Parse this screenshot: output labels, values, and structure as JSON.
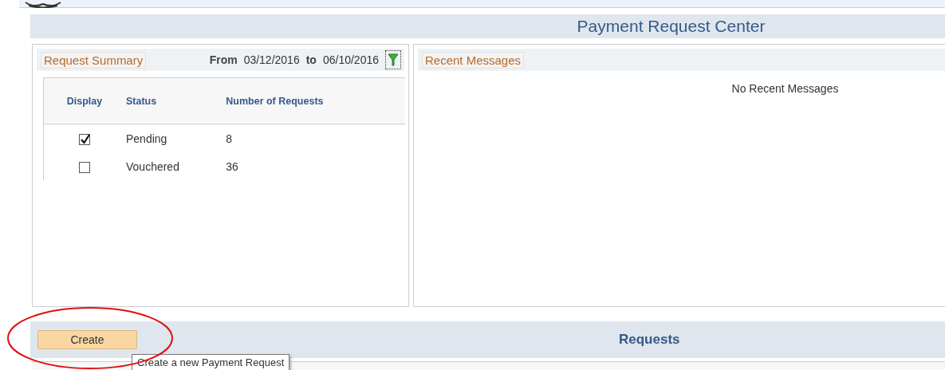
{
  "header": {
    "title": "Payment Request Center"
  },
  "summary": {
    "title": "Request Summary",
    "from_label": "From",
    "from_date": "03/12/2016",
    "to_label": "to",
    "to_date": "06/10/2016",
    "columns": [
      "Display",
      "Status",
      "Number of Requests"
    ],
    "rows": [
      {
        "status": "Pending",
        "count": "8",
        "checked": true
      },
      {
        "status": "Vouchered",
        "count": "36",
        "checked": false
      }
    ]
  },
  "messages": {
    "title": "Recent Messages",
    "empty_text": "No Recent Messages"
  },
  "requests": {
    "create_button": "Create",
    "title": "Requests",
    "tooltip": "Create a new Payment Request"
  }
}
